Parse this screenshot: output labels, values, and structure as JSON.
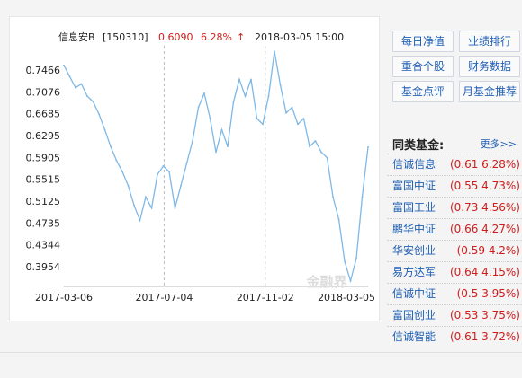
{
  "header": {
    "fund_name": "信息安B",
    "fund_code": "[150310]",
    "price": "0.6090",
    "change": "6.28%",
    "arrow": "↑",
    "datetime": "2018-03-05 15:00"
  },
  "colors": {
    "line": "#7fb8e6",
    "up": "#d21b1b",
    "link": "#1f5fb4",
    "grid": "#bbbbbb"
  },
  "chart_data": {
    "type": "line",
    "x_ticks": [
      "2017-03-06",
      "2017-07-04",
      "2017-11-02",
      "2018-03-05"
    ],
    "y_ticks": [
      "0.7466",
      "0.7076",
      "0.6685",
      "0.6295",
      "0.5905",
      "0.5515",
      "0.5125",
      "0.4735",
      "0.4344",
      "0.3954"
    ],
    "ylim": [
      0.36,
      0.79
    ],
    "grid": "vertical dashed at x ticks",
    "series": [
      {
        "x": [
          "2017-03-06",
          "2017-03-13",
          "2017-03-20",
          "2017-03-27",
          "2017-04-03",
          "2017-04-10",
          "2017-04-17",
          "2017-04-24",
          "2017-05-01",
          "2017-05-08",
          "2017-05-15",
          "2017-05-22",
          "2017-05-29",
          "2017-06-05",
          "2017-06-12",
          "2017-06-19",
          "2017-06-26",
          "2017-07-03",
          "2017-07-10",
          "2017-07-17",
          "2017-07-24",
          "2017-07-31",
          "2017-08-07",
          "2017-08-14",
          "2017-08-21",
          "2017-08-28",
          "2017-09-04",
          "2017-09-11",
          "2017-09-18",
          "2017-09-25",
          "2017-10-02",
          "2017-10-09",
          "2017-10-16",
          "2017-10-23",
          "2017-10-30",
          "2017-11-06",
          "2017-11-13",
          "2017-11-20",
          "2017-11-27",
          "2017-12-04",
          "2017-12-11",
          "2017-12-18",
          "2017-12-25",
          "2018-01-01",
          "2018-01-08",
          "2018-01-15",
          "2018-01-22",
          "2018-01-29",
          "2018-02-05",
          "2018-02-12",
          "2018-02-19",
          "2018-02-26",
          "2018-03-05"
        ],
        "y": [
          0.755,
          0.735,
          0.715,
          0.722,
          0.7,
          0.69,
          0.668,
          0.64,
          0.61,
          0.585,
          0.565,
          0.54,
          0.505,
          0.478,
          0.52,
          0.5,
          0.56,
          0.575,
          0.565,
          0.5,
          0.54,
          0.58,
          0.62,
          0.68,
          0.705,
          0.66,
          0.6,
          0.64,
          0.61,
          0.69,
          0.73,
          0.7,
          0.73,
          0.66,
          0.65,
          0.7,
          0.78,
          0.72,
          0.67,
          0.68,
          0.65,
          0.66,
          0.61,
          0.62,
          0.6,
          0.59,
          0.52,
          0.48,
          0.405,
          0.37,
          0.41,
          0.52,
          0.609
        ]
      }
    ]
  },
  "watermark": "金融界",
  "buttons": [
    "每日净值",
    "业绩排行",
    "重合个股",
    "财务数据",
    "基金点评",
    "月基金推荐"
  ],
  "peers": {
    "title": "同类基金:",
    "more": "更多>>",
    "items": [
      {
        "name": "信诚信息",
        "value": "(0.61 6.28%)"
      },
      {
        "name": "富国中证",
        "value": "(0.55 4.73%)"
      },
      {
        "name": "富国工业",
        "value": "(0.73 4.56%)"
      },
      {
        "name": "鹏华中证",
        "value": "(0.66 4.27%)"
      },
      {
        "name": "华安创业",
        "value": "(0.59 4.2%)"
      },
      {
        "name": "易方达军",
        "value": "(0.64 4.15%)"
      },
      {
        "name": "信诚中证",
        "value": "(0.5 3.95%)"
      },
      {
        "name": "富国创业",
        "value": "(0.53 3.75%)"
      },
      {
        "name": "信诚智能",
        "value": "(0.61 3.72%)"
      }
    ]
  }
}
